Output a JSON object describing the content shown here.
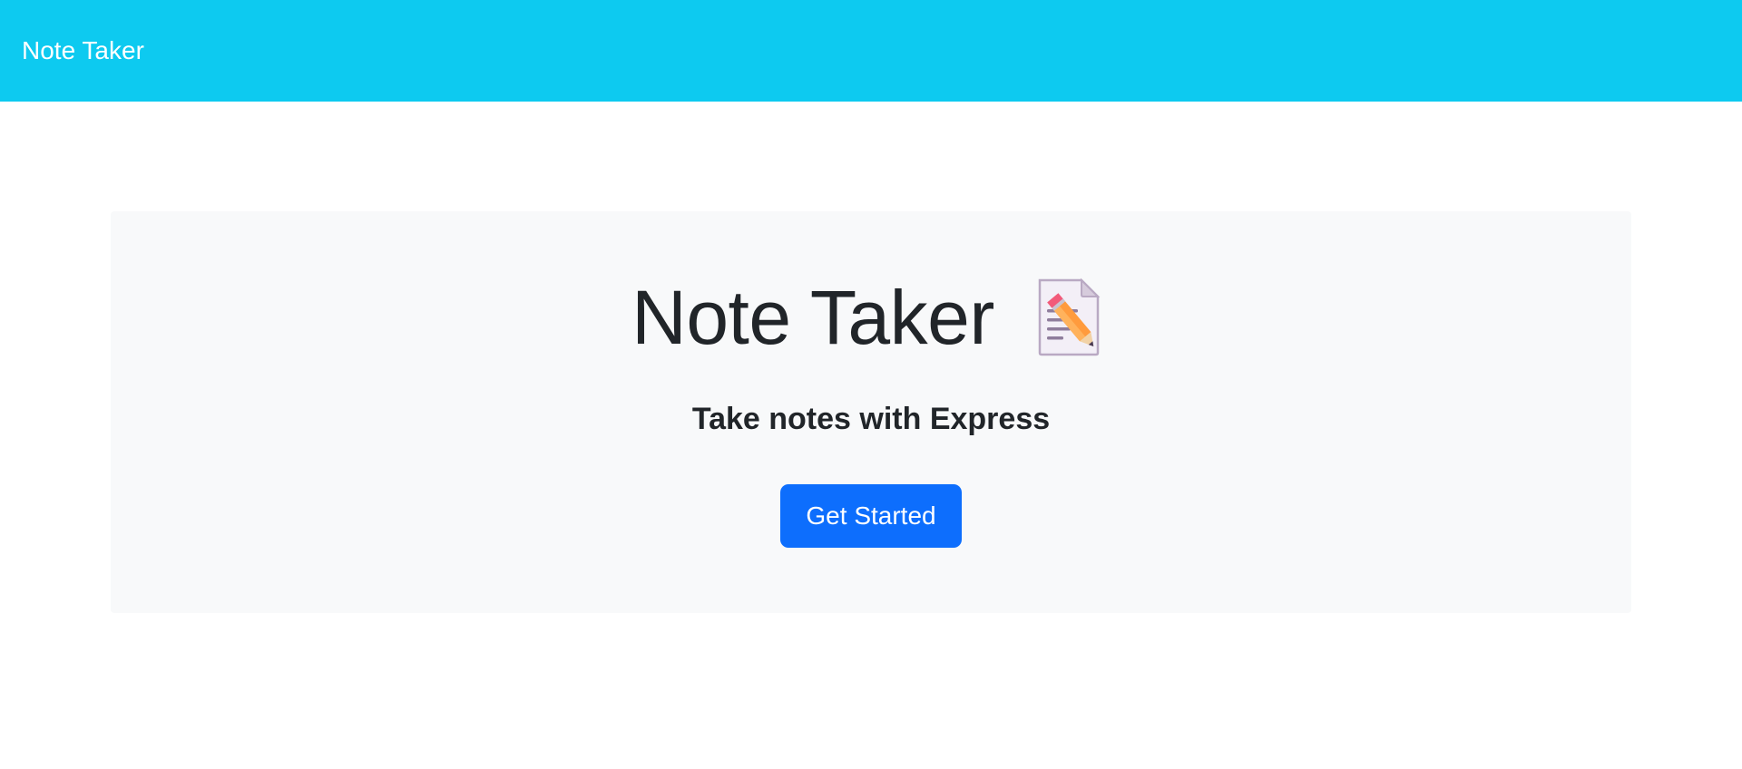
{
  "navbar": {
    "brand": "Note Taker"
  },
  "hero": {
    "title": "Note Taker",
    "title_icon": "memo-icon",
    "subtitle": "Take notes with Express",
    "cta_label": "Get Started"
  },
  "colors": {
    "navbar_bg": "#0dcaf0",
    "hero_bg": "#f8f9fa",
    "button_bg": "#0d6efd",
    "text": "#212529"
  }
}
